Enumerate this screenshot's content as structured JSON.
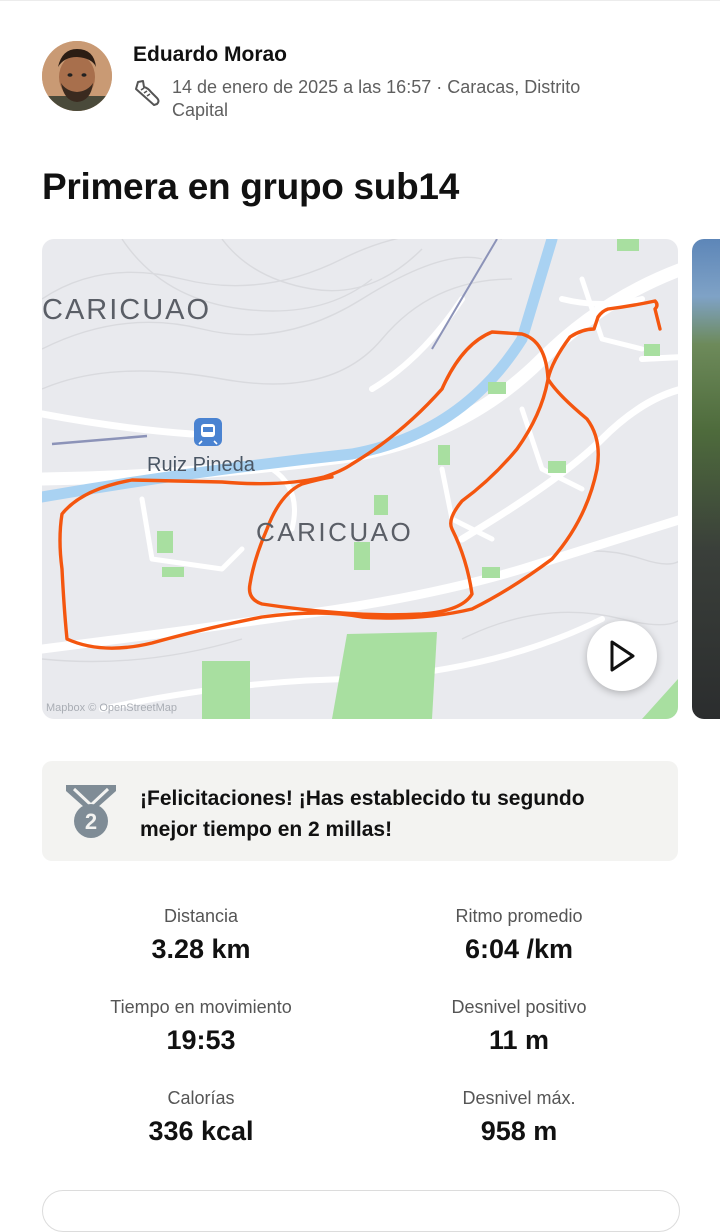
{
  "activity": {
    "athlete_name": "Eduardo Morao",
    "meta": "14 de enero de 2025 a las 16:57 · Caracas, Distrito Capital",
    "title": "Primera en grupo sub14",
    "sport_icon": "running-shoe-icon"
  },
  "map": {
    "labels": {
      "area_top": "CARICUAO",
      "station": "Ruiz Pineda",
      "area_center": "CARICUAO",
      "attribution": "Mapbox © OpenStreetMap"
    },
    "route_color": "#fc4c02",
    "station_icon": "metro-station-icon",
    "play_icon": "play-icon"
  },
  "achievement": {
    "text": "¡Felicitaciones! ¡Has establecido tu segundo mejor tiempo en 2 millas!",
    "rank": "2",
    "icon": "medal-icon"
  },
  "stats": [
    {
      "label": "Distancia",
      "value": "3.28 km"
    },
    {
      "label": "Ritmo promedio",
      "value": "6:04 /km"
    },
    {
      "label": "Tiempo en movimiento",
      "value": "19:53"
    },
    {
      "label": "Desnivel positivo",
      "value": "11 m"
    },
    {
      "label": "Calorías",
      "value": "336 kcal"
    },
    {
      "label": "Desnivel máx.",
      "value": "958 m"
    }
  ]
}
